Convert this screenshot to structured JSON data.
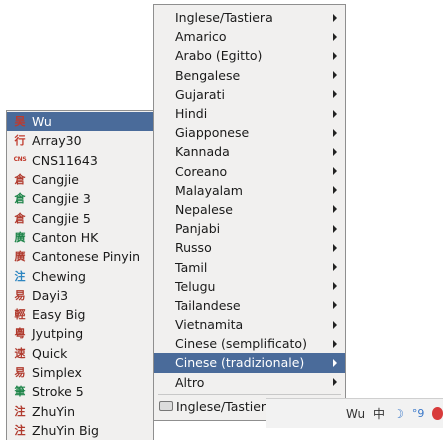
{
  "left_menu": {
    "items": [
      {
        "label": "Wu",
        "icon": "吴",
        "icon_name": "wu-icon",
        "icon_color": "#c0392b",
        "selected": true
      },
      {
        "label": "Array30",
        "icon": "行",
        "icon_name": "array30-icon",
        "icon_color": "#c0392b"
      },
      {
        "label": "CNS11643",
        "icon": "CNS",
        "icon_name": "cns11643-icon",
        "icon_color": "#c0392b",
        "small": true
      },
      {
        "label": "Cangjie",
        "icon": "倉",
        "icon_name": "cangjie-icon",
        "icon_color": "#b03a2e"
      },
      {
        "label": "Cangjie 3",
        "icon": "倉",
        "icon_name": "cangjie3-icon",
        "icon_color": "#1e8449"
      },
      {
        "label": "Cangjie 5",
        "icon": "倉",
        "icon_name": "cangjie5-icon",
        "icon_color": "#b03a2e"
      },
      {
        "label": "Canton HK",
        "icon": "廣",
        "icon_name": "canton-hk-icon",
        "icon_color": "#1e8449"
      },
      {
        "label": "Cantonese Pinyin",
        "icon": "廣",
        "icon_name": "cantonese-pinyin-icon",
        "icon_color": "#b03a2e"
      },
      {
        "label": "Chewing",
        "icon": "注",
        "icon_name": "chewing-icon",
        "icon_color": "#2e86c1"
      },
      {
        "label": "Dayi3",
        "icon": "易",
        "icon_name": "dayi3-icon",
        "icon_color": "#b03a2e"
      },
      {
        "label": "Easy Big",
        "icon": "輕",
        "icon_name": "easy-big-icon",
        "icon_color": "#b03a2e"
      },
      {
        "label": "Jyutping",
        "icon": "粵",
        "icon_name": "jyutping-icon",
        "icon_color": "#b03a2e"
      },
      {
        "label": "Quick",
        "icon": "速",
        "icon_name": "quick-icon",
        "icon_color": "#b03a2e"
      },
      {
        "label": "Simplex",
        "icon": "易",
        "icon_name": "simplex-icon",
        "icon_color": "#b03a2e"
      },
      {
        "label": "Stroke 5",
        "icon": "筆",
        "icon_name": "stroke5-icon",
        "icon_color": "#1e8449"
      },
      {
        "label": "ZhuYin",
        "icon": "注",
        "icon_name": "zhuyin-icon",
        "icon_color": "#b03a2e"
      },
      {
        "label": "ZhuYin Big",
        "icon": "注",
        "icon_name": "zhuyin-big-icon",
        "icon_color": "#b03a2e"
      }
    ]
  },
  "main_menu": {
    "items": [
      {
        "label": "Inglese/Tastiera",
        "submenu": true
      },
      {
        "label": "Amarico",
        "submenu": true
      },
      {
        "label": "Arabo (Egitto)",
        "submenu": true
      },
      {
        "label": "Bengalese",
        "submenu": true
      },
      {
        "label": "Gujarati",
        "submenu": true
      },
      {
        "label": "Hindi",
        "submenu": true
      },
      {
        "label": "Giapponese",
        "submenu": true
      },
      {
        "label": "Kannada",
        "submenu": true
      },
      {
        "label": "Coreano",
        "submenu": true
      },
      {
        "label": "Malayalam",
        "submenu": true
      },
      {
        "label": "Nepalese",
        "submenu": true
      },
      {
        "label": "Panjabi",
        "submenu": true
      },
      {
        "label": "Russo",
        "submenu": true
      },
      {
        "label": "Tamil",
        "submenu": true
      },
      {
        "label": "Telugu",
        "submenu": true
      },
      {
        "label": "Tailandese",
        "submenu": true
      },
      {
        "label": "Vietnamita",
        "submenu": true
      },
      {
        "label": "Cinese (semplificato)",
        "submenu": true
      },
      {
        "label": "Cinese (tradizionale)",
        "submenu": true,
        "selected": true
      },
      {
        "label": "Altro",
        "submenu": true
      }
    ],
    "footer_item": {
      "label": "Inglese/Tastiera",
      "icon_name": "keyboard-icon"
    }
  },
  "panel": {
    "im_label": "Wu",
    "mode_char": "中",
    "moon_icon": "☽",
    "quote_icon": "°9",
    "accent": "#4a6b9a"
  }
}
